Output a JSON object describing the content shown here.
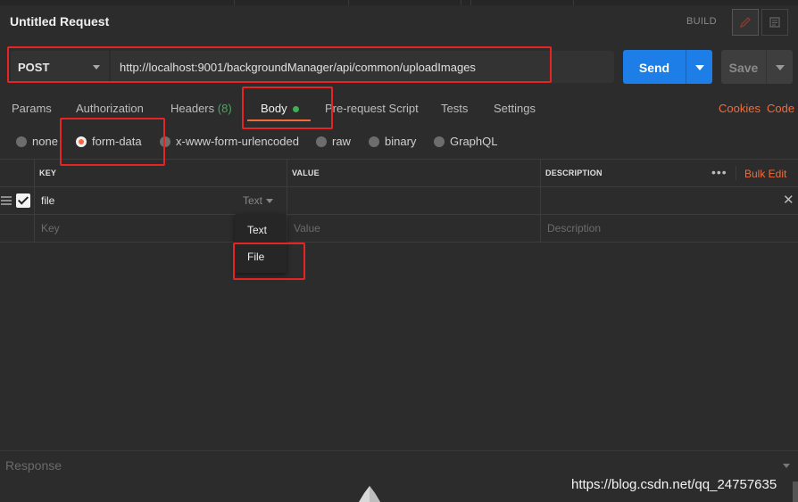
{
  "request": {
    "title": "Untitled Request",
    "build_label": "BUILD",
    "method": "POST",
    "url": "http://localhost:9001/backgroundManager/api/common/uploadImages",
    "send_label": "Send",
    "save_label": "Save"
  },
  "tabs": [
    {
      "label": "Params"
    },
    {
      "label": "Authorization"
    },
    {
      "label": "Headers",
      "count": "(8)"
    },
    {
      "label": "Body",
      "active": true
    },
    {
      "label": "Pre-request Script"
    },
    {
      "label": "Tests"
    },
    {
      "label": "Settings"
    }
  ],
  "links": {
    "cookies": "Cookies",
    "code": "Code"
  },
  "body_modes": [
    {
      "label": "none"
    },
    {
      "label": "form-data",
      "selected": true
    },
    {
      "label": "x-www-form-urlencoded"
    },
    {
      "label": "raw"
    },
    {
      "label": "binary"
    },
    {
      "label": "GraphQL"
    }
  ],
  "table": {
    "headers": {
      "key": "KEY",
      "value": "VALUE",
      "description": "DESCRIPTION"
    },
    "more": "•••",
    "bulk_edit": "Bulk Edit",
    "row": {
      "key": "file",
      "type": "Text",
      "checked": true
    },
    "placeholders": {
      "key": "Key",
      "value": "Value",
      "description": "Description"
    }
  },
  "type_dropdown": {
    "options": [
      "Text",
      "File"
    ]
  },
  "response": {
    "label": "Response"
  },
  "watermark": "https://blog.csdn.net/qq_24757635",
  "colors": {
    "accent": "#f26b3a",
    "send": "#1c7ee6",
    "highlight": "#e52424",
    "green": "#3fae55"
  }
}
